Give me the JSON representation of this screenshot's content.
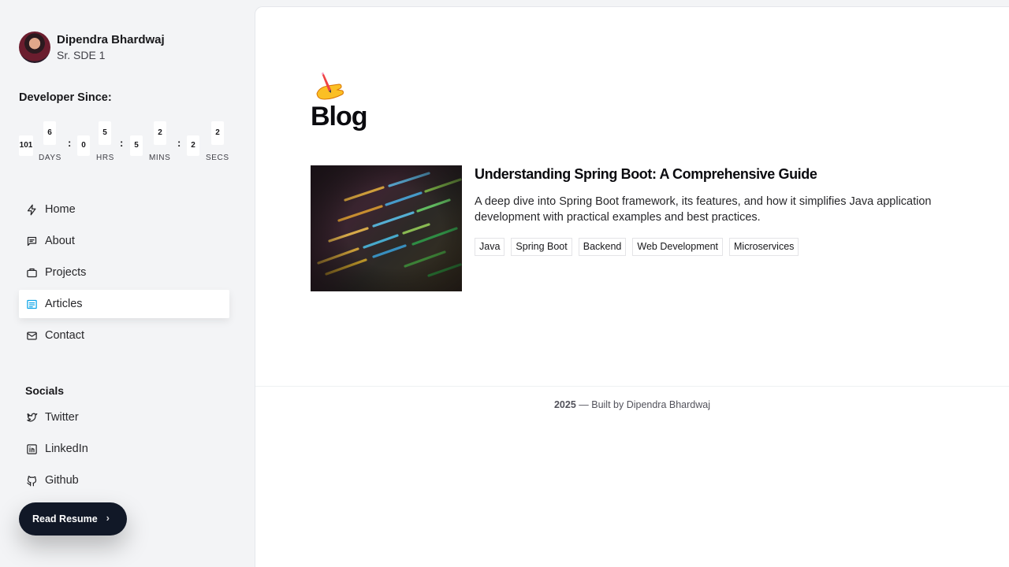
{
  "profile": {
    "name": "Dipendra Bhardwaj",
    "role": "Sr. SDE 1"
  },
  "developer_since": {
    "label": "Developer Since:",
    "days_digits": [
      "101",
      "6"
    ],
    "hrs_digits": [
      "0",
      "5"
    ],
    "mins_digits": [
      "5",
      "2"
    ],
    "secs_digits": [
      "2",
      "2"
    ],
    "units": {
      "days": "DAYS",
      "hrs": "HRS",
      "mins": "MINS",
      "secs": "SECS"
    },
    "separator": ":"
  },
  "nav": {
    "items": [
      {
        "label": "Home",
        "icon": "bolt-icon"
      },
      {
        "label": "About",
        "icon": "message-icon"
      },
      {
        "label": "Projects",
        "icon": "briefcase-icon"
      },
      {
        "label": "Articles",
        "icon": "article-icon",
        "active": true
      },
      {
        "label": "Contact",
        "icon": "mail-icon"
      }
    ]
  },
  "socials": {
    "label": "Socials",
    "items": [
      {
        "label": "Twitter",
        "icon": "twitter-icon"
      },
      {
        "label": "LinkedIn",
        "icon": "linkedin-icon"
      },
      {
        "label": "Github",
        "icon": "github-icon"
      }
    ]
  },
  "resume": {
    "label": "Read Resume",
    "chevron": "›"
  },
  "main": {
    "emoji": "writing-hand-icon",
    "title": "Blog",
    "articles": [
      {
        "title": "Understanding Spring Boot: A Comprehensive Guide",
        "description": "A deep dive into Spring Boot framework, its features, and how it simplifies Java application development with practical examples and best practices.",
        "tags": [
          "Java",
          "Spring Boot",
          "Backend",
          "Web Development",
          "Microservices"
        ]
      }
    ]
  },
  "footer": {
    "year": "2025",
    "text": " — Built by Dipendra Bhardwaj"
  },
  "colors": {
    "accent": "#0ea5e9",
    "sidebar_bg": "#f3f4f6",
    "button_bg": "#111827"
  }
}
